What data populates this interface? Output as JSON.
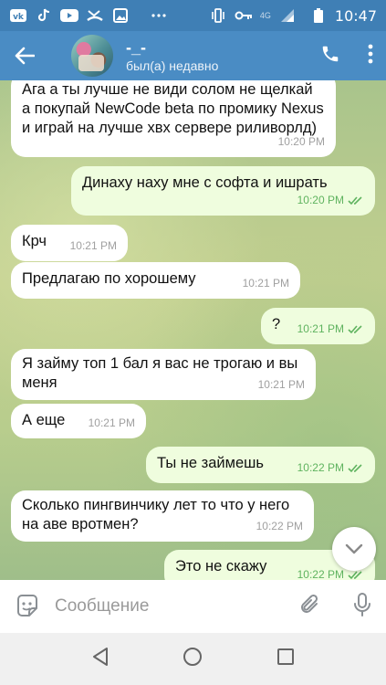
{
  "status_bar": {
    "time": "10:47",
    "network": "4G",
    "icons": [
      "vk-icon",
      "tiktok-icon",
      "youtube-icon",
      "missed-call-icon",
      "gallery-icon",
      "more-icon",
      "vibrate-icon",
      "key-icon",
      "signal-icon",
      "battery-icon"
    ]
  },
  "header": {
    "title": "-_-",
    "status": "был(а) недавно"
  },
  "messages": [
    {
      "dir": "in",
      "text": "Ага а ты лучше не види солом не щелкай а покупай NewCode beta по промику Nexus и играй на лучше хвх сервере риливорлд)",
      "time": "10:20 PM"
    },
    {
      "dir": "out",
      "text": "Динаху наху мне с софта и ишрать",
      "time": "10:20 PM"
    },
    {
      "dir": "in",
      "text": "Крч",
      "time": "10:21 PM"
    },
    {
      "dir": "in",
      "text": "Предлагаю по хорошему",
      "time": "10:21 PM"
    },
    {
      "dir": "out",
      "text": "?",
      "time": "10:21 PM"
    },
    {
      "dir": "in",
      "text": "Я займу топ 1 бал я вас не трогаю и вы меня",
      "time": "10:21 PM"
    },
    {
      "dir": "in",
      "text": "А еще",
      "time": "10:21 PM"
    },
    {
      "dir": "out",
      "text": "Ты не займешь",
      "time": "10:22 PM"
    },
    {
      "dir": "in",
      "text": "Сколько пингвинчику лет то что у него на аве вротмен?",
      "time": "10:22 PM"
    },
    {
      "dir": "out",
      "text": "Это не скажу",
      "time": "10:22 PM"
    }
  ],
  "composer": {
    "placeholder": "Сообщение"
  },
  "colors": {
    "header": "#4a8cc4",
    "status_bar": "#3f7fb5",
    "outgoing_bubble": "#effdde",
    "incoming_bubble": "#ffffff",
    "read_check": "#5fb35f"
  }
}
